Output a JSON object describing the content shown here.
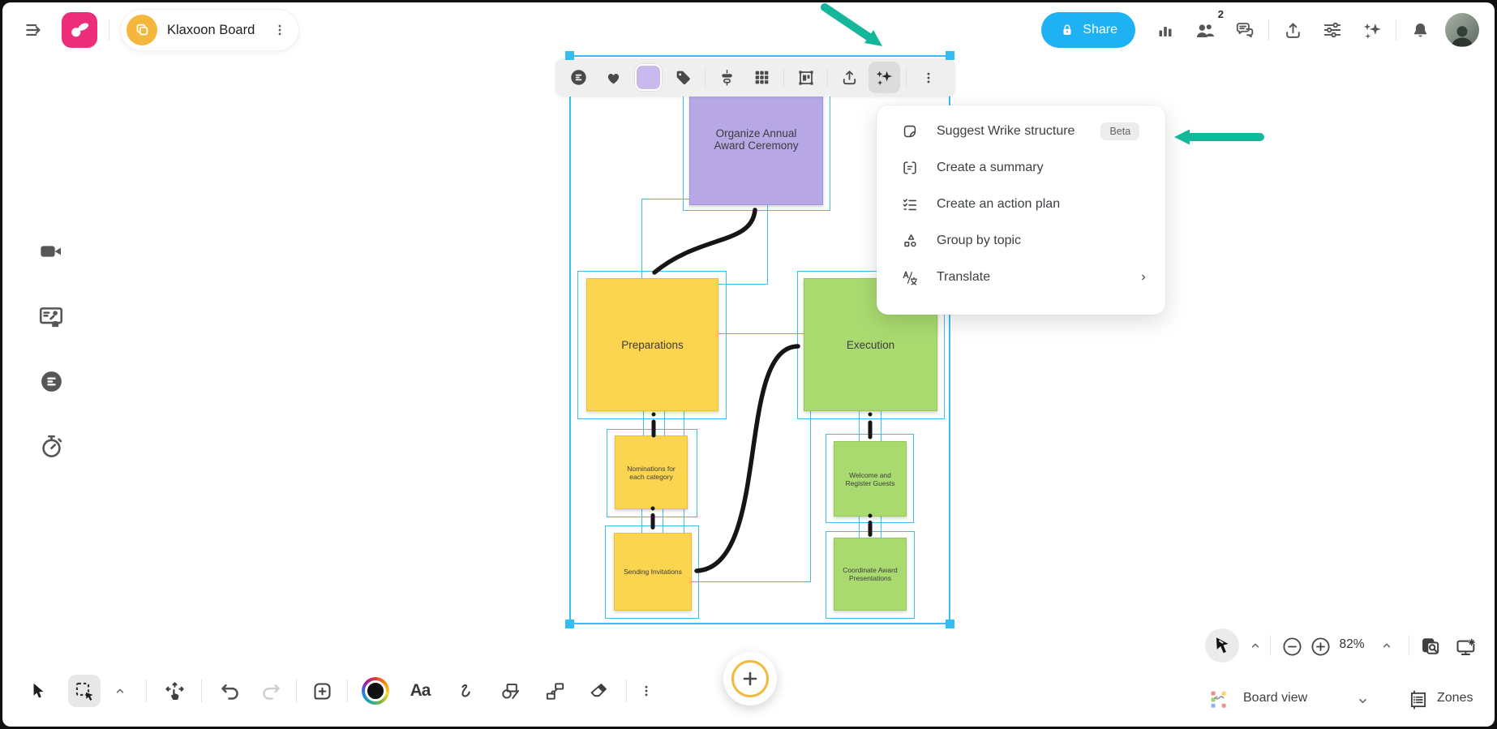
{
  "header": {
    "title": "Klaxoon Board",
    "share_label": "Share",
    "collaborators_badge": "2",
    "left_icons": [
      "sidebar-toggle-icon",
      "klaxoon-logo",
      "board-icon",
      "kebab-menu-icon"
    ],
    "right_icons": [
      "lock-icon",
      "stats-icon",
      "participants-icon",
      "comments-icon",
      "upload-icon",
      "settings-sliders-icon",
      "ai-sparkles-icon",
      "notification-bell-icon",
      "user-avatar"
    ]
  },
  "selection_toolbar": {
    "icons": [
      "details-icon",
      "like-heart-icon",
      "color-swatch",
      "tag-icon",
      "align-icon",
      "grid-icon",
      "frame-icon",
      "export-icon",
      "ai-sparkles-icon",
      "more-options-icon"
    ],
    "swatch_color": "#c9b9ef",
    "active_icon": "ai-sparkles-icon"
  },
  "context_menu": {
    "items": [
      {
        "label": "Suggest Wrike structure",
        "badge": "Beta",
        "icon": "sticky-note-icon"
      },
      {
        "label": "Create a summary",
        "icon": "summary-icon"
      },
      {
        "label": "Create an action plan",
        "icon": "action-plan-icon"
      },
      {
        "label": "Group by topic",
        "icon": "group-by-topic-icon"
      },
      {
        "label": "Translate",
        "icon": "translate-icon",
        "submenu": true
      }
    ]
  },
  "board": {
    "stickies": [
      {
        "label": "Organize Annual Award Ceremony",
        "color": "#b7a8e5"
      },
      {
        "label": "Preparations",
        "color": "#fbd54f"
      },
      {
        "label": "Execution",
        "color": "#a9da70"
      },
      {
        "label": "Nominations for each category",
        "color": "#fbd54f"
      },
      {
        "label": "Sending Invitations",
        "color": "#fbd54f"
      },
      {
        "label": "Welcome and Register Guests",
        "color": "#a9da70"
      },
      {
        "label": "Coordinate Award Presentations",
        "color": "#a9da70"
      }
    ],
    "selection_color": "#35bdf0",
    "connector_color": "#151515"
  },
  "left_toolbar": {
    "icons": [
      "video-icon",
      "presenter-icon",
      "poll-icon",
      "timer-icon"
    ]
  },
  "bottom_toolbar": {
    "text_tool_label": "Aa",
    "icons": [
      "cursor-icon",
      "marquee-select-icon",
      "chevron-up-icon",
      "pan-icon",
      "undo-icon",
      "redo-icon",
      "add-note-icon",
      "color-wheel",
      "text-tool",
      "draw-icon",
      "shapes-icon",
      "connector-icon",
      "eraser-icon",
      "more-options-icon"
    ],
    "active_icon": "marquee-select-icon"
  },
  "zoom_controls": {
    "zoom_level": "82%",
    "icons": [
      "laser-pointer-icon",
      "chevron-up-icon",
      "zoom-out-icon",
      "zoom-in-icon",
      "chevron-up-icon",
      "overview-icon",
      "display-settings-icon"
    ]
  },
  "view_controls": {
    "view_label": "Board view",
    "zones_label": "Zones"
  },
  "annotations": {
    "arrow_color": "#15b79a"
  },
  "colors": {
    "share_button": "#1eb1f3",
    "brand_pink": "#ee2d7a",
    "board_icon_yellow": "#f5b73b",
    "plus_ring_yellow": "#f2b93e",
    "toolbar_bg": "#efefef"
  }
}
